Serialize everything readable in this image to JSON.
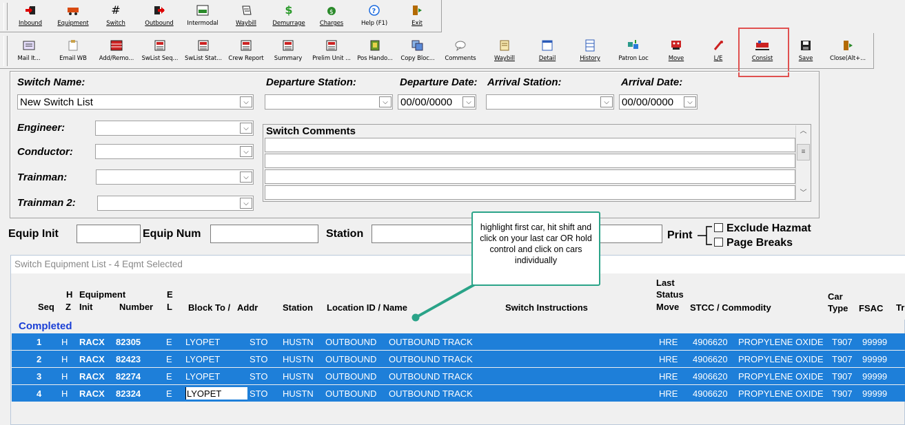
{
  "toolbar1": [
    {
      "label": "Inbound",
      "icon": "inbound-icon",
      "color": "#c00"
    },
    {
      "label": "Equipment",
      "icon": "equipment-icon",
      "color": "#d03010"
    },
    {
      "label": "Switch",
      "icon": "switch-icon",
      "color": "#222"
    },
    {
      "label": "Outbound",
      "icon": "outbound-icon",
      "color": "#c00"
    },
    {
      "label": "Intermodal",
      "icon": "intermodal-icon",
      "color": "#1a5"
    },
    {
      "label": "Waybill",
      "icon": "waybill-icon",
      "color": "#333"
    },
    {
      "label": "Demurrage",
      "icon": "demurrage-icon",
      "color": "#2a9a2a"
    },
    {
      "label": "Charges",
      "icon": "charges-icon",
      "color": "#2a8a2a"
    },
    {
      "label": "Help (F1)",
      "icon": "help-icon",
      "color": "#1a6adf"
    },
    {
      "label": "Exit",
      "icon": "exit-icon",
      "color": "#b36a00"
    }
  ],
  "toolbar2": [
    {
      "label": "Mail It...",
      "icon": "mail-icon"
    },
    {
      "label": "Email WB",
      "icon": "email-waybill-icon"
    },
    {
      "label": "Add/Remo...",
      "icon": "add-remove-icon"
    },
    {
      "label": "SwList Seq...",
      "icon": "swlist-seq-icon"
    },
    {
      "label": "SwList Stat...",
      "icon": "swlist-stat-icon"
    },
    {
      "label": "Crew Report",
      "icon": "crew-report-icon"
    },
    {
      "label": "Summary",
      "icon": "summary-icon"
    },
    {
      "label": "Prelim Unit ...",
      "icon": "prelim-unit-icon"
    },
    {
      "label": "Pos Hando...",
      "icon": "pos-handoff-icon"
    },
    {
      "label": "Copy Bloc...",
      "icon": "copy-block-icon"
    },
    {
      "label": "Comments",
      "icon": "comments-icon"
    },
    {
      "label": "Waybill",
      "icon": "waybill-doc-icon"
    },
    {
      "label": "Detail",
      "icon": "detail-icon"
    },
    {
      "label": "History",
      "icon": "history-icon"
    },
    {
      "label": "Patron Loc",
      "icon": "patron-loc-icon"
    },
    {
      "label": "Move",
      "icon": "move-icon"
    },
    {
      "label": "L/E",
      "icon": "load-empty-icon"
    },
    {
      "label": "Consist",
      "icon": "consist-icon"
    },
    {
      "label": "Save",
      "icon": "save-icon"
    },
    {
      "label": "Close(Alt+...",
      "icon": "close-door-icon"
    }
  ],
  "header": {
    "switch_name_label": "Switch Name:",
    "switch_name_value": "New Switch List",
    "departure_station_label": "Departure Station:",
    "departure_station_value": "",
    "departure_date_label": "Departure Date:",
    "departure_date_value": "00/00/0000",
    "arrival_station_label": "Arrival Station:",
    "arrival_station_value": "",
    "arrival_date_label": "Arrival Date:",
    "arrival_date_value": "00/00/0000",
    "engineer_label": "Engineer:",
    "conductor_label": "Conductor:",
    "trainman_label": "Trainman:",
    "trainman2_label": "Trainman 2:",
    "comments_label": "Switch Comments"
  },
  "search": {
    "equip_init_label": "Equip Init",
    "equip_num_label": "Equip Num",
    "station_label": "Station",
    "print_label": "Print",
    "exclude_hazmat_label": "Exclude Hazmat",
    "page_breaks_label": "Page Breaks"
  },
  "grid": {
    "title": "Switch Equipment List - 4 Eqmt Selected",
    "group_label": "Completed",
    "headers": {
      "seq": "Seq",
      "hz_h": "H",
      "hz_z": "Z",
      "equipment": "Equipment",
      "init": "Init",
      "number": "Number",
      "el_e": "E",
      "el_l": "L",
      "block_to": "Block To /",
      "addr": "Addr",
      "station": "Station",
      "location": "Location ID / Name",
      "instructions": "Switch Instructions",
      "last": "Last",
      "status": "Status",
      "move": "Move",
      "stcc": "STCC / Commodity",
      "car": "Car",
      "type": "Type",
      "fsac": "FSAC",
      "tr": "Tr"
    },
    "rows": [
      {
        "seq": "1",
        "hz": "H",
        "init": "RACX",
        "number": "82305",
        "el": "E",
        "block": "LYOPET",
        "addr": "STO",
        "station": "HUSTN",
        "loc_id": "OUTBOUND",
        "loc_name": "OUTBOUND TRACK",
        "move": "HRE",
        "stcc": "4906620",
        "commodity": "PROPYLENE OXIDE",
        "car_type": "T907",
        "fsac": "99999"
      },
      {
        "seq": "2",
        "hz": "H",
        "init": "RACX",
        "number": "82423",
        "el": "E",
        "block": "LYOPET",
        "addr": "STO",
        "station": "HUSTN",
        "loc_id": "OUTBOUND",
        "loc_name": "OUTBOUND TRACK",
        "move": "HRE",
        "stcc": "4906620",
        "commodity": "PROPYLENE OXIDE",
        "car_type": "T907",
        "fsac": "99999"
      },
      {
        "seq": "3",
        "hz": "H",
        "init": "RACX",
        "number": "82274",
        "el": "E",
        "block": "LYOPET",
        "addr": "STO",
        "station": "HUSTN",
        "loc_id": "OUTBOUND",
        "loc_name": "OUTBOUND TRACK",
        "move": "HRE",
        "stcc": "4906620",
        "commodity": "PROPYLENE OXIDE",
        "car_type": "T907",
        "fsac": "99999"
      },
      {
        "seq": "4",
        "hz": "H",
        "init": "RACX",
        "number": "82324",
        "el": "E",
        "block": "LYOPET",
        "addr": "STO",
        "station": "HUSTN",
        "loc_id": "OUTBOUND",
        "loc_name": "OUTBOUND TRACK",
        "move": "HRE",
        "stcc": "4906620",
        "commodity": "PROPYLENE OXIDE",
        "car_type": "T907",
        "fsac": "99999"
      }
    ]
  },
  "callout": {
    "text": "highlight first car, hit shift and click on your last car OR hold control and click on cars individually"
  }
}
